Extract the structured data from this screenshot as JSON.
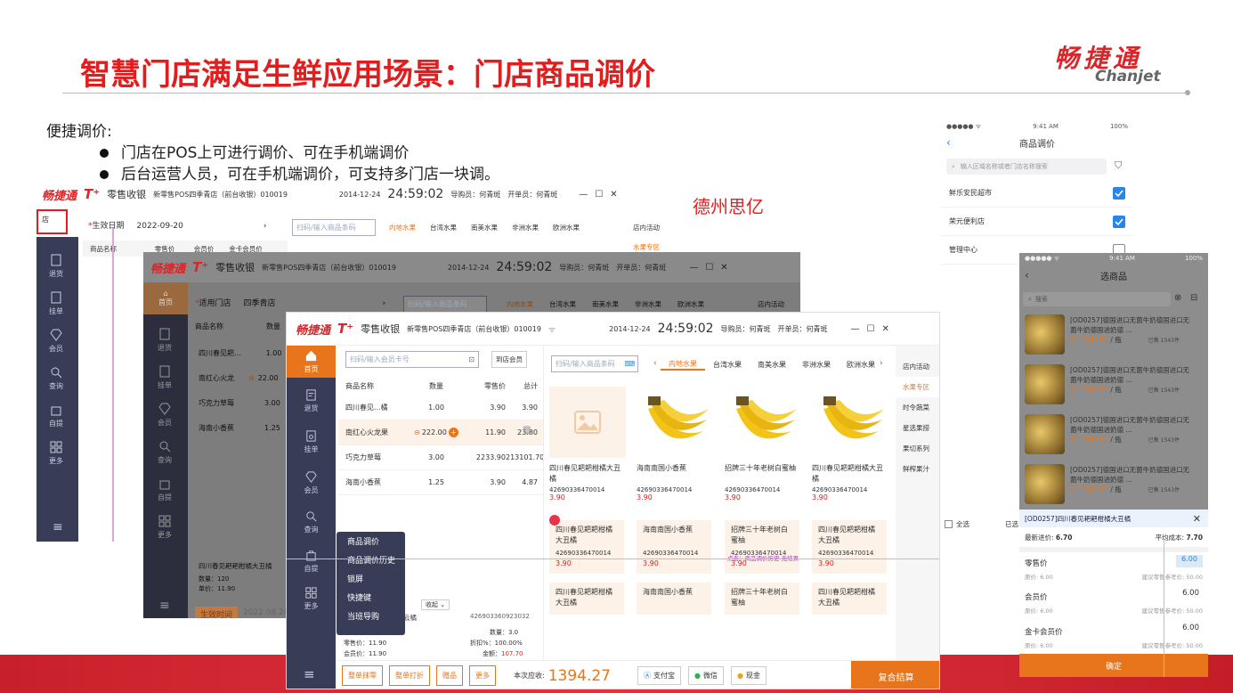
{
  "slide": {
    "title": "智慧门店满足生鲜应用场景：门店商品调价",
    "logo_cn": "畅捷通",
    "logo_en": "Chanjet",
    "intro": "便捷调价:",
    "bullets": [
      "门店在POS上可进行调价、可在手机端调价",
      "后台运营人员，可在手机端调价，可支持多门店一块调。"
    ],
    "company_label": "德州思亿"
  },
  "colors": {
    "brand_red": "#e31d1d",
    "accent_orange": "#e8751b",
    "sidebar": "#383c56",
    "mobile_blue": "#2a86e4"
  },
  "win1": {
    "brand": "畅捷通",
    "tplus": "T⁺",
    "module": "零售收银",
    "store": "新零售POS四季青店（前台收银）010019",
    "date": "2014-12-24",
    "time": "24:59:02",
    "guide": "导购员：何青斑",
    "cashier": "开单员：何青斑",
    "left_box": "店",
    "date_label": "生效日期",
    "date_value": "2022-09-20",
    "search_placeholder": "扫码/输入商品条码",
    "tabs": [
      "内地水果",
      "台湾水果",
      "南美水果",
      "非洲水果",
      "欧洲水果"
    ],
    "shop_activity": "店内活动",
    "fruit_zone": "水果专区",
    "cols": [
      "商品名称",
      "零售价",
      "会员价",
      "金卡会员价"
    ],
    "nav": [
      "退货",
      "挂单",
      "会员",
      "查询",
      "自提",
      "更多"
    ]
  },
  "win2": {
    "brand": "畅捷通",
    "tplus": "T⁺",
    "module": "零售收银",
    "store": "新零售POS四季青店（前台收银）010019",
    "date": "2014-12-24",
    "time": "24:59:02",
    "guide": "导购员：何青斑",
    "cashier": "开单员：何青斑",
    "store_label": "适用门店",
    "store_value": "四季青店",
    "search_placeholder": "扫码/输入商品条码",
    "tabs": [
      "内地水果",
      "台湾水果",
      "南美水果",
      "非洲水果",
      "欧洲水果"
    ],
    "shop_activity": "店内活动",
    "cols": [
      "商品名称",
      "数量"
    ],
    "rows": [
      {
        "name": "四川春见耙...",
        "qty": "1.00"
      },
      {
        "name": "南红心火龙",
        "qty": "22.00"
      },
      {
        "name": "巧克力草莓",
        "qty": "3.00"
      },
      {
        "name": "海南小香蕉",
        "qty": "1.25"
      }
    ],
    "detail_name": "四川春见耙耙柑橘大丑橘",
    "detail_qty": "数量：120",
    "detail_price": "单价：11.90",
    "effect_btn": "生效时间",
    "effect_date": "2022.08.20",
    "nav": [
      "首页",
      "退货",
      "挂单",
      "会员",
      "查询",
      "自提",
      "更多"
    ]
  },
  "win3": {
    "brand": "畅捷通",
    "tplus": "T⁺",
    "module": "零售收银",
    "store": "新零售POS四季青店（前台收银）010019",
    "date": "2014-12-24",
    "time": "24:59:02",
    "guide": "导购员：何青斑",
    "cashier": "开单员：何青斑",
    "member_placeholder": "扫码/输入会员卡号",
    "member_btn": "到店会员",
    "product_placeholder": "扫码/输入商品条码",
    "cols": [
      "商品名称",
      "数量",
      "零售价",
      "总计"
    ],
    "rows": [
      {
        "name": "四川春见...橘",
        "qty": "1.00",
        "price": "3.90",
        "total": "3.90"
      },
      {
        "name": "南红心火龙果",
        "qty": "222.00",
        "price": "11.90",
        "total": "23.80"
      },
      {
        "name": "巧克力草莓",
        "qty": "3.00",
        "price": "2233.90",
        "total": "213101.70"
      },
      {
        "name": "海南小香蕉",
        "qty": "1.25",
        "price": "3.90",
        "total": "4.87"
      }
    ],
    "tabs": [
      "内地水果",
      "台湾水果",
      "南美水果",
      "非洲水果",
      "欧洲水果"
    ],
    "right_cats": [
      "店内活动",
      "水果专区",
      "时令蔬菜",
      "星选果捞",
      "果切系列",
      "鲜榨果汁"
    ],
    "cards": [
      {
        "name": "四川春见耙耙柑橘大丑橘",
        "code": "42690336470014",
        "price": "3.90"
      },
      {
        "name": "海南南国小香蕉",
        "code": "42690336470014",
        "price": "3.90"
      },
      {
        "name": "招牌三十年老树白蜜柚",
        "code": "42690336470014",
        "price": "3.90"
      },
      {
        "name": "四川春见耙耙柑橘大丑橘",
        "code": "42690336470014",
        "price": "3.90"
      }
    ],
    "tiles_row1": [
      {
        "name": "四川春见耙耙柑橘大丑橘",
        "code": "42690336470014",
        "price": "3.90"
      },
      {
        "name": "海南南国小香蕉",
        "code": "42690336470014",
        "price": "3.90"
      },
      {
        "name": "招牌三十年老树白蜜柚",
        "code": "42690336470014",
        "price": "3.90"
      },
      {
        "name": "四川春见耙耙柑橘大丑橘",
        "code": "42690336470014",
        "price": "3.90"
      }
    ],
    "tiles_row2": [
      "四川春见耙耙柑橘大丑橘",
      "海南南国小香蕉",
      "招牌三十年老树白蜜柚",
      "四川春见耙耙柑橘大丑橘"
    ],
    "tile_overlay": "点击：商品调价历史   无结果",
    "menu": [
      "商品调价",
      "商品调价历史",
      "锁屏",
      "快捷键",
      "当班导购"
    ],
    "collapse": "收起",
    "detail": {
      "name": "云橘",
      "code": "426903360923032",
      "qty": "数量：3.0",
      "retail": "零售价：11.90",
      "discount": "折扣%：100.00%",
      "member": "会员价：11.90",
      "amount_label": "金额：",
      "amount": "107.70"
    },
    "nav": [
      "首页",
      "退货",
      "挂单",
      "会员",
      "查询",
      "自提",
      "更多"
    ],
    "buttons": [
      "整单抹零",
      "整单打折",
      "赠品",
      "更多"
    ],
    "due_label": "本次应收:",
    "due": "1394.27",
    "pay": [
      "支付宝",
      "微信",
      "现金"
    ],
    "checkout": "复合结算"
  },
  "phone1": {
    "carrier": "●●●●● ᯤ",
    "time": "9:41 AM",
    "battery": "100%",
    "title": "商品调价",
    "search_placeholder": "输入区域名称或者门店名称搜索",
    "stores": [
      {
        "name": "鲜乐安民超市",
        "checked": true
      },
      {
        "name": "荣元便利店",
        "checked": true
      },
      {
        "name": "管理中心",
        "checked": false
      }
    ],
    "select_all": "全选",
    "selected": "已选"
  },
  "phone2": {
    "carrier": "●●●●● ᯤ",
    "time": "9:41 AM",
    "battery": "100%",
    "title": "选商品",
    "search_placeholder": "搜索",
    "items": [
      {
        "name": "[OD0257]德国进口无菌牛奶德国进口无菌牛奶德国进奶德 ...",
        "price": "¥ 12345.83",
        "unit": "/ 瓶",
        "stock": "已售 1543件"
      },
      {
        "name": "[OD0257]德国进口无菌牛奶德国进口无菌牛奶德国进奶德 ...",
        "price": "¥ 12345.83",
        "unit": "/ 瓶",
        "stock": "已售 1543件"
      },
      {
        "name": "[OD0257]德国进口无菌牛奶德国进口无菌牛奶德国进奶德 ...",
        "price": "¥ 12345.83",
        "unit": "/ 瓶",
        "stock": "已售 1543件"
      },
      {
        "name": "[OD0257]德国进口无菌牛奶德国进口无菌牛奶德国进奶德 ...",
        "price": "¥ 12345.83",
        "unit": "/ 瓶",
        "stock": "已售 1543件"
      }
    ],
    "edit_title": "[OD0257]四川春见耙耙柑橘大丑橘",
    "latest_label": "最新进价:",
    "latest": "6.70",
    "avg_label": "平均成本:",
    "avg": "7.70",
    "rows": [
      {
        "label": "零售价",
        "value": "6.00",
        "orig": "原价: 6.00",
        "ref": "建议零售参考价: 50.00"
      },
      {
        "label": "会员价",
        "value": "6.00",
        "orig": "原价: 6.00",
        "ref": "建议零售参考价: 50.00"
      },
      {
        "label": "金卡会员价",
        "value": "6.00",
        "orig": "原价: 6.00",
        "ref": "建议零售参考价: 50.00"
      }
    ],
    "confirm": "确定"
  }
}
